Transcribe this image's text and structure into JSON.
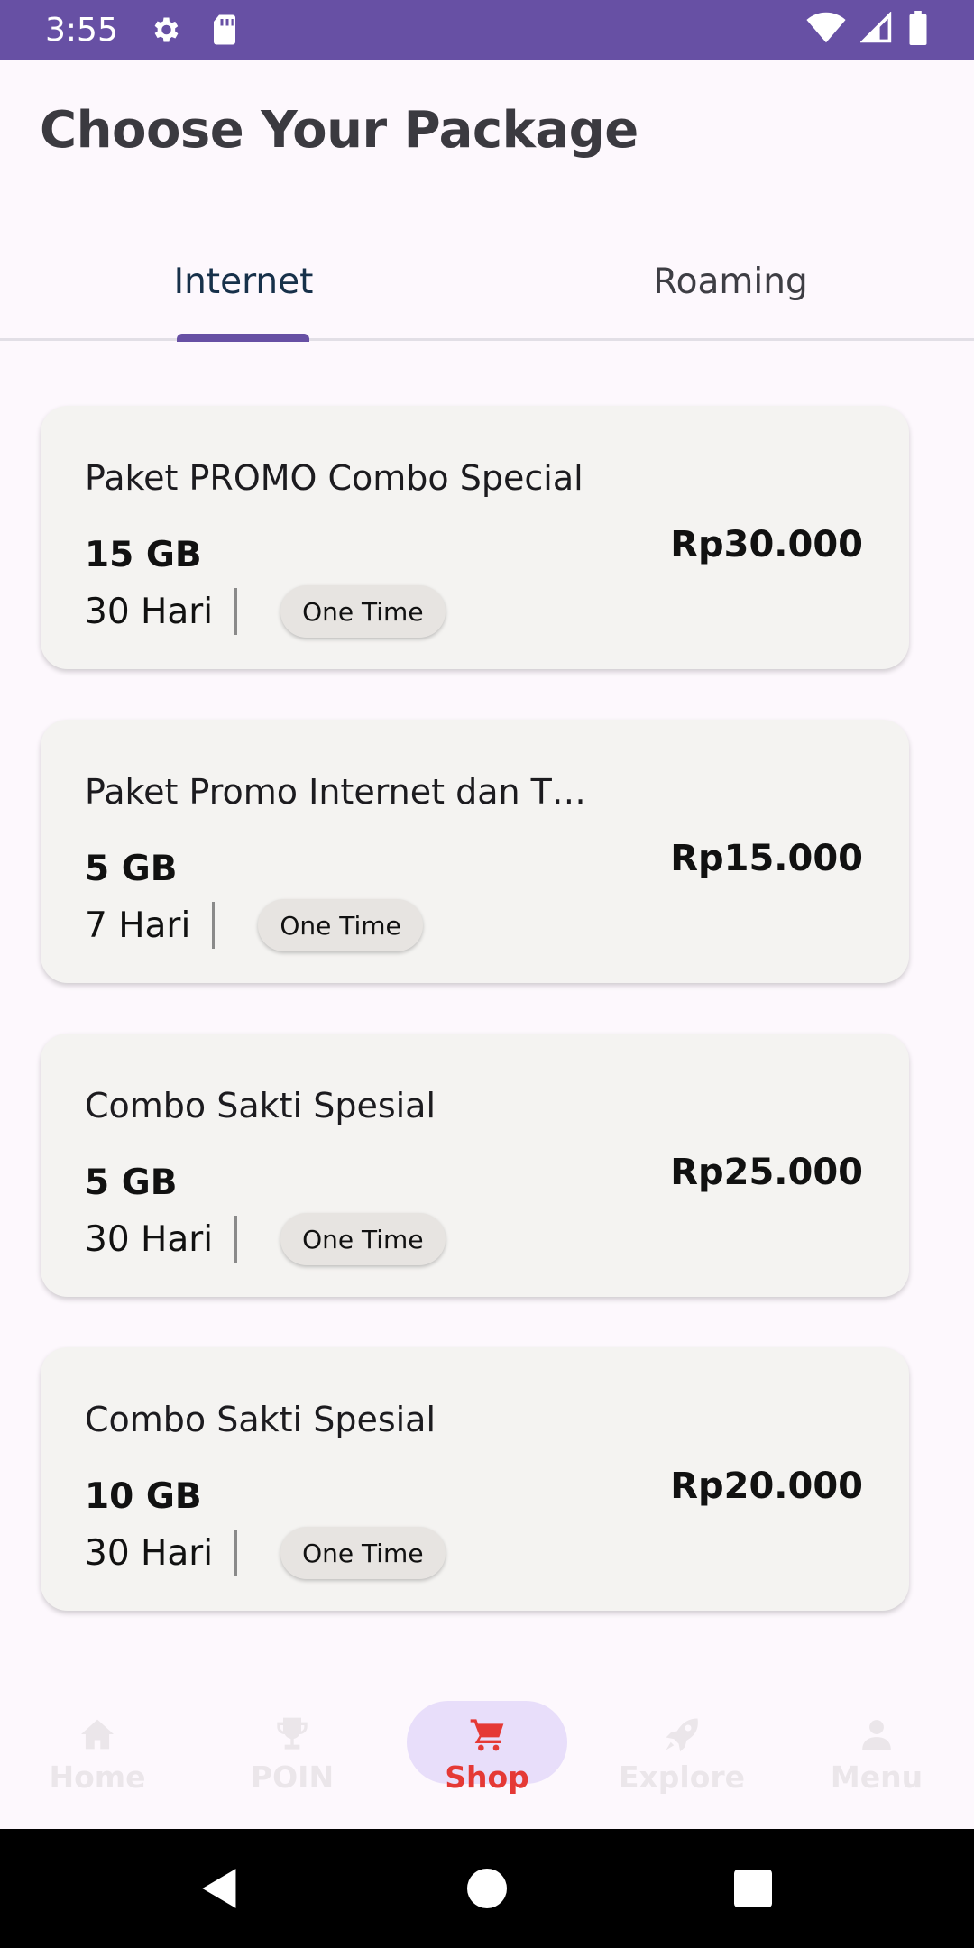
{
  "status_bar": {
    "time": "3:55",
    "left_icons": [
      "gear-icon",
      "sd-card-icon"
    ],
    "right_icons": [
      "wifi-icon",
      "signal-icon",
      "battery-icon"
    ],
    "color": "#6750a4"
  },
  "page": {
    "title": "Choose Your Package"
  },
  "tabs": {
    "items": [
      {
        "label": "Internet",
        "selected": true
      },
      {
        "label": "Roaming",
        "selected": false
      }
    ],
    "indicator_color": "#6750a4"
  },
  "packages": [
    {
      "name": "Paket PROMO Combo Special",
      "quota": "15 GB",
      "duration": "30 Hari",
      "type": "One Time",
      "price": "Rp30.000"
    },
    {
      "name": "Paket Promo Internet dan T…",
      "quota": "5 GB",
      "duration": "7 Hari",
      "type": "One Time",
      "price": "Rp15.000"
    },
    {
      "name": "Combo Sakti Spesial",
      "quota": "5 GB",
      "duration": "30 Hari",
      "type": "One Time",
      "price": "Rp25.000"
    },
    {
      "name": "Combo Sakti Spesial",
      "quota": "10 GB",
      "duration": "30 Hari",
      "type": "One Time",
      "price": "Rp20.000"
    }
  ],
  "bottom_nav": {
    "items": [
      {
        "label": "Home",
        "icon": "home-icon",
        "active": false
      },
      {
        "label": "POIN",
        "icon": "trophy-icon",
        "active": false
      },
      {
        "label": "Shop",
        "icon": "cart-icon",
        "active": true
      },
      {
        "label": "Explore",
        "icon": "rocket-icon",
        "active": false
      },
      {
        "label": "Menu",
        "icon": "person-icon",
        "active": false
      }
    ],
    "active_color": "#e53935",
    "pill_color": "#e8defa"
  },
  "system_nav": {
    "buttons": [
      "back-icon",
      "home-circle-icon",
      "recents-square-icon"
    ]
  }
}
